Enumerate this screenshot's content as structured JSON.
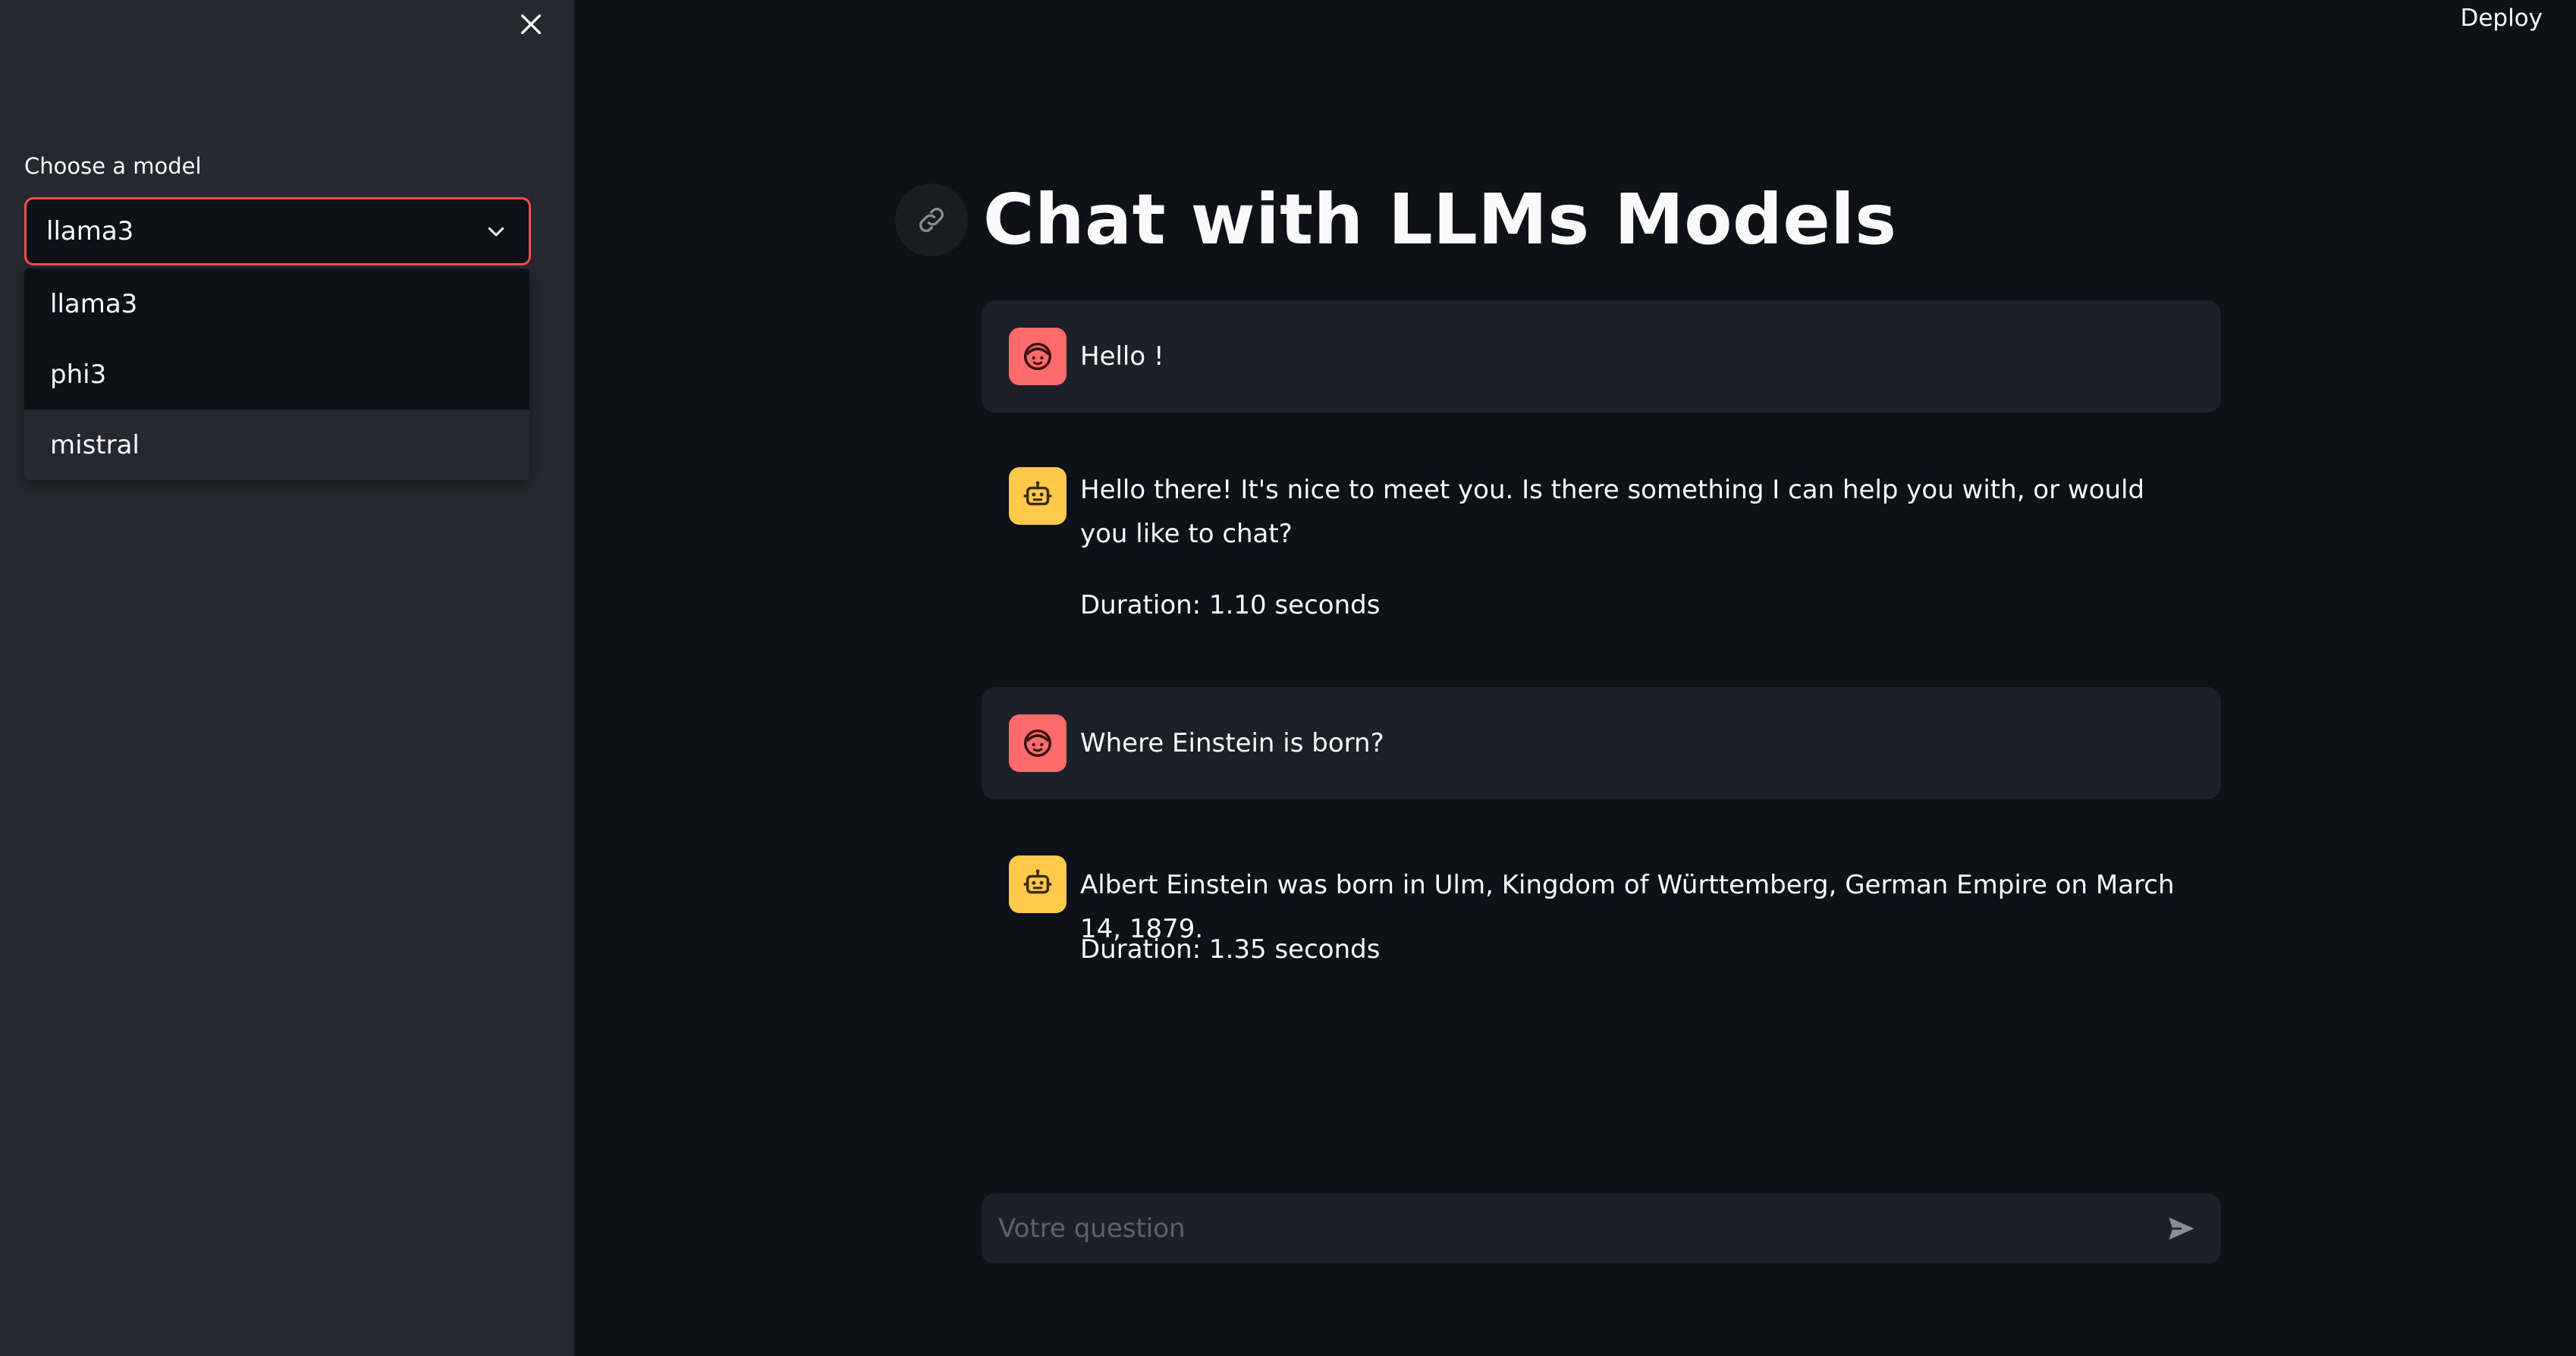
{
  "sidebar": {
    "model_label": "Choose a model",
    "selected_model": "llama3",
    "options": [
      "llama3",
      "phi3",
      "mistral"
    ]
  },
  "header": {
    "deploy_label": "Deploy"
  },
  "main": {
    "title": "Chat with LLMs Models",
    "messages": [
      {
        "role": "user",
        "text": "Hello !"
      },
      {
        "role": "assistant",
        "text": "Hello there! It's nice to meet you. Is there something I can help you with, or would you like to chat?",
        "duration": "Duration: 1.10 seconds"
      },
      {
        "role": "user",
        "text": "Where Einstein is born?"
      },
      {
        "role": "assistant",
        "text": "Albert Einstein was born in Ulm, Kingdom of Württemberg, German Empire on March 14, 1879.",
        "duration": "Duration: 1.35 seconds"
      }
    ],
    "chat_input": {
      "placeholder": "Votre question",
      "value": ""
    }
  },
  "colors": {
    "accent": "#ff4b4b",
    "user_avatar": "#ff6b6b",
    "assistant_avatar": "#ffc94a",
    "background": "#0e1117",
    "sidebar_background": "#262730"
  },
  "icons": {
    "close": "close-icon",
    "chevron": "chevron-down-icon",
    "anchor": "link-icon",
    "user_avatar": "user-face-icon",
    "assistant_avatar": "robot-icon",
    "send": "send-icon"
  }
}
